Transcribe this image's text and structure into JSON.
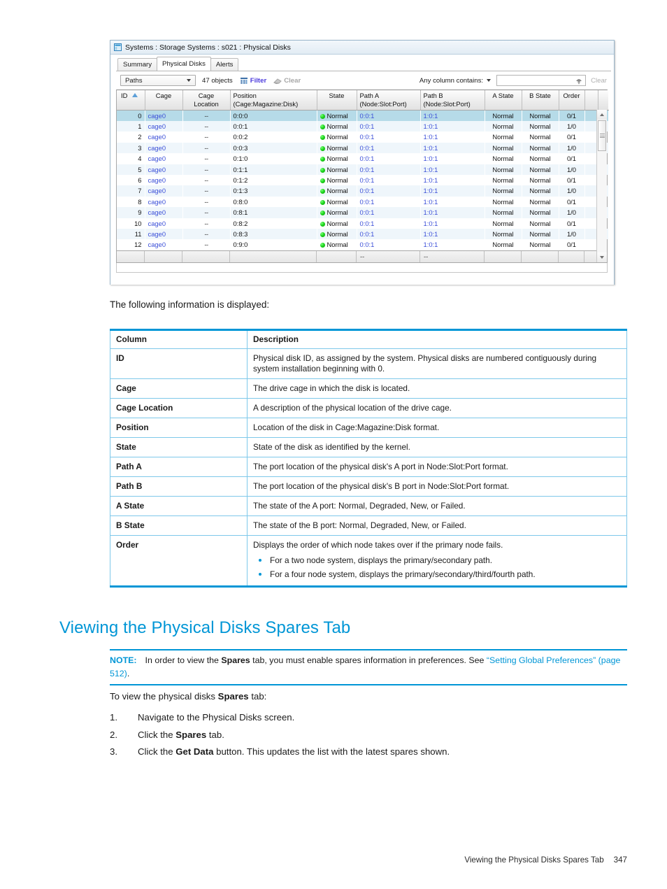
{
  "screenshot": {
    "window_icon": "window-panel-icon",
    "title": "Systems : Storage Systems : s021 : Physical Disks",
    "tabs": [
      {
        "label": "Summary",
        "active": false
      },
      {
        "label": "Physical Disks",
        "active": true
      },
      {
        "label": "Alerts",
        "active": false
      }
    ],
    "toolbar": {
      "view_select_value": "Paths",
      "object_count": "47 objects",
      "filter_label": "Filter",
      "filter_icon": "filter-icon",
      "clear_label": "Clear",
      "clear_icon": "eraser-icon",
      "any_column_label": "Any column contains:",
      "dropdown_icon": "chevron-down-icon",
      "search_value": "",
      "search_placeholder": "",
      "search_icon": "search-lamp-icon",
      "clear_right_label": "Clear"
    },
    "grid": {
      "columns": [
        {
          "label": "ID",
          "sort": "ascending",
          "sort_icon": "sort-ascending-icon"
        },
        {
          "label": "Cage"
        },
        {
          "label": "Cage Location"
        },
        {
          "label": "Position",
          "sublabel": "(Cage:Magazine:Disk)"
        },
        {
          "label": "State"
        },
        {
          "label": "Path A",
          "sublabel": "(Node:Slot:Port)"
        },
        {
          "label": "Path B",
          "sublabel": "(Node:Slot:Port)"
        },
        {
          "label": "A State"
        },
        {
          "label": "B State"
        },
        {
          "label": "Order"
        }
      ],
      "rows": [
        {
          "id": "0",
          "cage": "cage0",
          "cage_location": "--",
          "position": "0:0:0",
          "state": "Normal",
          "state_icon": "green-status-dot",
          "path_a": "0:0:1",
          "path_b": "1:0:1",
          "a_state": "Normal",
          "b_state": "Normal",
          "order": "0/1",
          "selected": true
        },
        {
          "id": "1",
          "cage": "cage0",
          "cage_location": "--",
          "position": "0:0:1",
          "state": "Normal",
          "state_icon": "green-status-dot",
          "path_a": "0:0:1",
          "path_b": "1:0:1",
          "a_state": "Normal",
          "b_state": "Normal",
          "order": "1/0"
        },
        {
          "id": "2",
          "cage": "cage0",
          "cage_location": "--",
          "position": "0:0:2",
          "state": "Normal",
          "state_icon": "green-status-dot",
          "path_a": "0:0:1",
          "path_b": "1:0:1",
          "a_state": "Normal",
          "b_state": "Normal",
          "order": "0/1"
        },
        {
          "id": "3",
          "cage": "cage0",
          "cage_location": "--",
          "position": "0:0:3",
          "state": "Normal",
          "state_icon": "green-status-dot",
          "path_a": "0:0:1",
          "path_b": "1:0:1",
          "a_state": "Normal",
          "b_state": "Normal",
          "order": "1/0"
        },
        {
          "id": "4",
          "cage": "cage0",
          "cage_location": "--",
          "position": "0:1:0",
          "state": "Normal",
          "state_icon": "green-status-dot",
          "path_a": "0:0:1",
          "path_b": "1:0:1",
          "a_state": "Normal",
          "b_state": "Normal",
          "order": "0/1"
        },
        {
          "id": "5",
          "cage": "cage0",
          "cage_location": "--",
          "position": "0:1:1",
          "state": "Normal",
          "state_icon": "green-status-dot",
          "path_a": "0:0:1",
          "path_b": "1:0:1",
          "a_state": "Normal",
          "b_state": "Normal",
          "order": "1/0"
        },
        {
          "id": "6",
          "cage": "cage0",
          "cage_location": "--",
          "position": "0:1:2",
          "state": "Normal",
          "state_icon": "green-status-dot",
          "path_a": "0:0:1",
          "path_b": "1:0:1",
          "a_state": "Normal",
          "b_state": "Normal",
          "order": "0/1"
        },
        {
          "id": "7",
          "cage": "cage0",
          "cage_location": "--",
          "position": "0:1:3",
          "state": "Normal",
          "state_icon": "green-status-dot",
          "path_a": "0:0:1",
          "path_b": "1:0:1",
          "a_state": "Normal",
          "b_state": "Normal",
          "order": "1/0"
        },
        {
          "id": "8",
          "cage": "cage0",
          "cage_location": "--",
          "position": "0:8:0",
          "state": "Normal",
          "state_icon": "green-status-dot",
          "path_a": "0:0:1",
          "path_b": "1:0:1",
          "a_state": "Normal",
          "b_state": "Normal",
          "order": "0/1"
        },
        {
          "id": "9",
          "cage": "cage0",
          "cage_location": "--",
          "position": "0:8:1",
          "state": "Normal",
          "state_icon": "green-status-dot",
          "path_a": "0:0:1",
          "path_b": "1:0:1",
          "a_state": "Normal",
          "b_state": "Normal",
          "order": "1/0"
        },
        {
          "id": "10",
          "cage": "cage0",
          "cage_location": "--",
          "position": "0:8:2",
          "state": "Normal",
          "state_icon": "green-status-dot",
          "path_a": "0:0:1",
          "path_b": "1:0:1",
          "a_state": "Normal",
          "b_state": "Normal",
          "order": "0/1"
        },
        {
          "id": "11",
          "cage": "cage0",
          "cage_location": "--",
          "position": "0:8:3",
          "state": "Normal",
          "state_icon": "green-status-dot",
          "path_a": "0:0:1",
          "path_b": "1:0:1",
          "a_state": "Normal",
          "b_state": "Normal",
          "order": "1/0"
        },
        {
          "id": "12",
          "cage": "cage0",
          "cage_location": "--",
          "position": "0:9:0",
          "state": "Normal",
          "state_icon": "green-status-dot",
          "path_a": "0:0:1",
          "path_b": "1:0:1",
          "a_state": "Normal",
          "b_state": "Normal",
          "order": "0/1"
        }
      ],
      "footer_row": {
        "path_a": "--",
        "path_b": "--"
      },
      "scrollbar": {
        "up_icon": "scroll-up-arrow-icon",
        "down_icon": "scroll-down-arrow-icon"
      }
    }
  },
  "lead_text": "The following information is displayed:",
  "desc_table": {
    "headers": {
      "column": "Column",
      "description": "Description"
    },
    "rows": [
      {
        "name": "ID",
        "description": "Physical disk ID, as assigned by the system. Physical disks are numbered contiguously during system installation beginning with 0."
      },
      {
        "name": "Cage",
        "description": "The drive cage in which the disk is located."
      },
      {
        "name": "Cage Location",
        "description": "A description of the physical location of the drive cage."
      },
      {
        "name": "Position",
        "description": "Location of the disk in Cage:Magazine:Disk format."
      },
      {
        "name": "State",
        "description": "State of the disk as identified by the kernel."
      },
      {
        "name": "Path A",
        "description": "The port location of the physical disk's A port in Node:Slot:Port format."
      },
      {
        "name": "Path B",
        "description": "The port location of the physical disk's B port in Node:Slot:Port format."
      },
      {
        "name": "A State",
        "description": "The state of the A port: Normal, Degraded, New, or Failed."
      },
      {
        "name": "B State",
        "description": "The state of the B port: Normal, Degraded, New, or Failed."
      },
      {
        "name": "Order",
        "description": "Displays the order of which node takes over if the primary node fails.",
        "bullets": [
          "For a two node system, displays the primary/secondary path.",
          "For a four node system, displays the primary/secondary/third/fourth path."
        ]
      }
    ]
  },
  "section_heading": "Viewing the Physical Disks Spares Tab",
  "note": {
    "label": "NOTE:",
    "text_part1": "In order to view the ",
    "bold1": "Spares",
    "text_part2": " tab, you must enable spares information in preferences. See ",
    "link": "“Setting Global Preferences” (page 512)",
    "text_part3": "."
  },
  "procedure": {
    "intro_part1": "To view the physical disks ",
    "intro_bold": "Spares",
    "intro_part2": " tab:",
    "steps": [
      {
        "num": "1.",
        "part1": "Navigate to the Physical Disks screen.",
        "bold": "",
        "part2": ""
      },
      {
        "num": "2.",
        "part1": "Click the ",
        "bold": "Spares",
        "part2": " tab."
      },
      {
        "num": "3.",
        "part1": "Click the ",
        "bold": "Get Data",
        "part2": " button. This updates the list with the latest spares shown."
      }
    ]
  },
  "page_footer": {
    "title": "Viewing the Physical Disks Spares Tab",
    "page": "347"
  },
  "colors": {
    "accent_blue": "#0096d6",
    "table_border_blue": "#7ec8ea",
    "link_blue": "#3b4fd8",
    "status_green": "#1fd81f",
    "row_selected": "#b6dbe8",
    "row_alt": "#eff6fb"
  }
}
